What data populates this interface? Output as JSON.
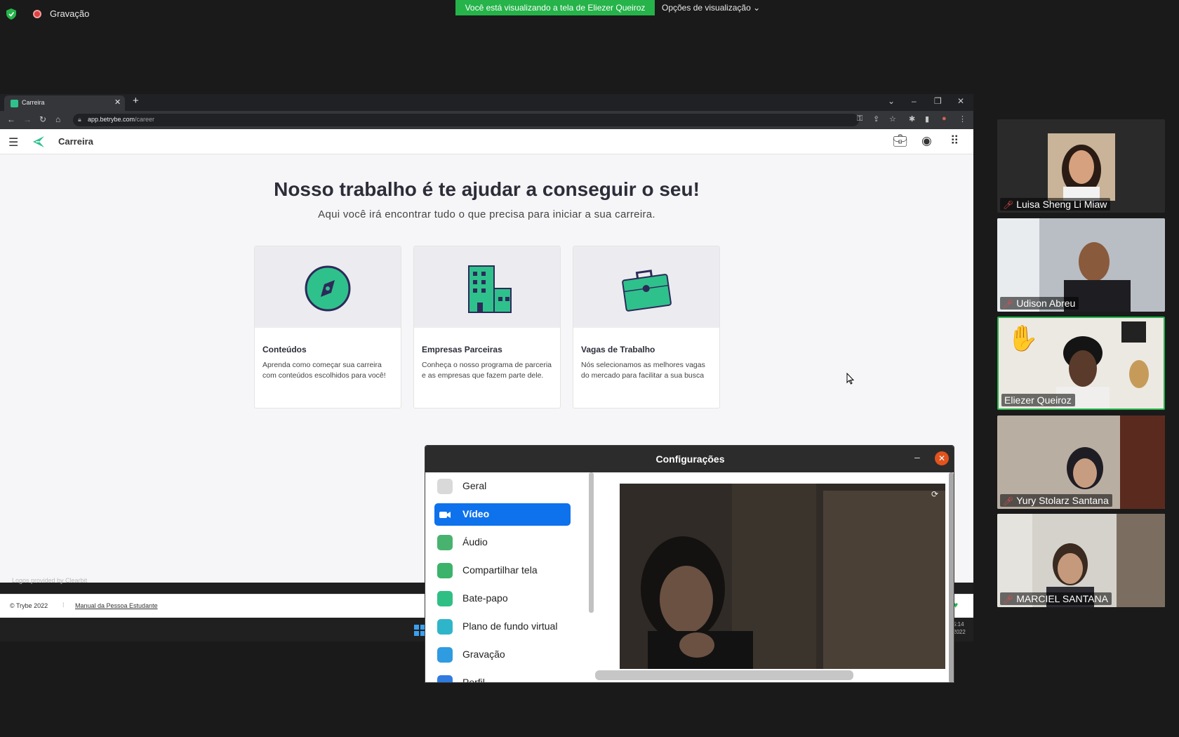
{
  "zoom": {
    "recording_label": "Gravação",
    "viewing_banner": "Você está visualizando a tela de Eliezer Queiroz",
    "view_options": "Opções de visualização"
  },
  "browser": {
    "tab_title": "Carreira",
    "url_host": "app.betrybe.com",
    "url_path": "/career"
  },
  "page": {
    "site_title": "Carreira",
    "hero_title": "Nosso trabalho é te ajudar a conseguir o seu!",
    "hero_subtitle": "Aqui você irá encontrar tudo o que precisa para iniciar a sua carreira.",
    "cards": [
      {
        "title": "Conteúdos",
        "desc": "Aprenda como começar sua carreira com conteúdos escolhidos para você!",
        "icon": "compass-icon"
      },
      {
        "title": "Empresas Parceiras",
        "desc": "Conheça o nosso programa de parceria e as empresas que fazem parte dele.",
        "icon": "building-icon"
      },
      {
        "title": "Vagas de Trabalho",
        "desc": "Nós selecionamos as melhores vagas do mercado para facilitar a sua busca",
        "icon": "briefcase-icon"
      }
    ],
    "logos_note": "Logos provided by Clearbit",
    "footer_copy": "© Trybe 2022",
    "footer_link": "Manual da Pessoa Estudante"
  },
  "taskbar": {
    "time": "5:14",
    "date": "2022"
  },
  "settings": {
    "title": "Configurações",
    "nav": [
      {
        "label": "Geral",
        "color": "#d9d9d9"
      },
      {
        "label": "Vídeo",
        "color": "#ffffff",
        "active": true
      },
      {
        "label": "Áudio",
        "color": "#48b36e"
      },
      {
        "label": "Compartilhar tela",
        "color": "#3bb36a"
      },
      {
        "label": "Bate-papo",
        "color": "#2fbf84"
      },
      {
        "label": "Plano de fundo virtual",
        "color": "#2fb5c9"
      },
      {
        "label": "Gravação",
        "color": "#2f9be0"
      },
      {
        "label": "Perfil",
        "color": "#2f7be0"
      }
    ]
  },
  "participants": [
    {
      "name": "Luisa Sheng Li Miaw",
      "muted": true
    },
    {
      "name": "Udison Abreu",
      "muted": true
    },
    {
      "name": "Eliezer Queiroz",
      "muted": false,
      "hand_raised": true,
      "speaking": true
    },
    {
      "name": "Yury Stolarz Santana",
      "muted": true
    },
    {
      "name": "MARCIEL SANTANA",
      "muted": true
    }
  ],
  "colors": {
    "accent_green": "#25b34a",
    "zoom_blue": "#0e72ed",
    "trybe_green": "#2fc18c"
  }
}
